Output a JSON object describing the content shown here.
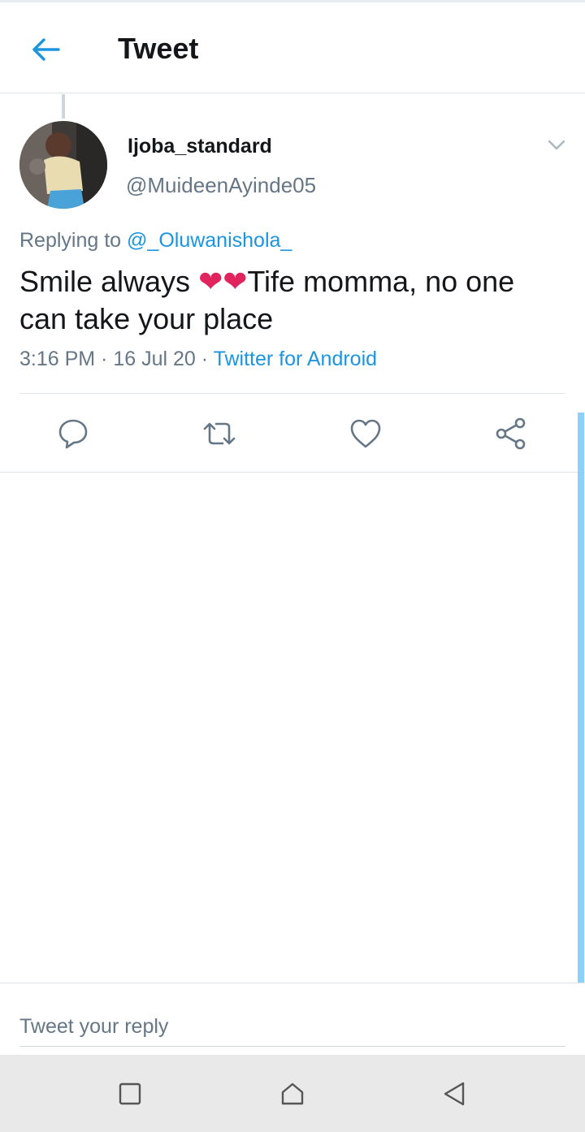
{
  "header": {
    "title": "Tweet"
  },
  "tweet": {
    "display_name": "Ijoba_standard",
    "handle": "@MuideenAyinde05",
    "replying_prefix": "Replying to ",
    "replying_to": "@_Oluwanishola_",
    "text_part1": "Smile always ",
    "hearts": "❤❤",
    "text_part2": "Tife momma, no one can take your place",
    "time": "3:16 PM · 16 Jul 20 · ",
    "source": "Twitter for Android"
  },
  "actions": [
    "reply-icon",
    "retweet-icon",
    "like-icon",
    "share-icon"
  ],
  "reply_bar": {
    "placeholder": "Tweet your reply"
  },
  "colors": {
    "accent": "#1b95e0",
    "secondary_text": "#657786",
    "heart": "#e0245e"
  }
}
